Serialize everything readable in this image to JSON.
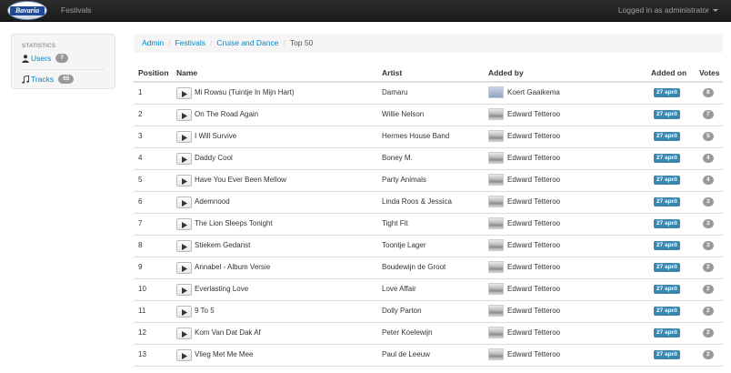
{
  "navbar": {
    "brand": "Bavaria",
    "link": "Festivals",
    "user": "Logged in as administrator"
  },
  "sidebar": {
    "header": "STATISTICS",
    "items": [
      {
        "label": "Users",
        "count": "7",
        "icon": "user-icon"
      },
      {
        "label": "Tracks",
        "count": "65",
        "icon": "music-icon"
      }
    ]
  },
  "breadcrumb": {
    "items": [
      "Admin",
      "Festivals",
      "Cruise and Dance"
    ],
    "current": "Top 50"
  },
  "table": {
    "headers": {
      "position": "Position",
      "name": "Name",
      "artist": "Artist",
      "added_by": "Added by",
      "added_on": "Added on",
      "votes": "Votes"
    },
    "rows": [
      {
        "position": "1",
        "name": "Mi Rowsu (Tuintje In Mijn Hart)",
        "artist": "Damaru",
        "added_by": "Koert Gaaikema",
        "added_on": "27 april",
        "votes": "8"
      },
      {
        "position": "2",
        "name": "On The Road Again",
        "artist": "Willie Nelson",
        "added_by": "Edward Tetteroo",
        "added_on": "27 april",
        "votes": "7"
      },
      {
        "position": "3",
        "name": "I Will Survive",
        "artist": "Hermes House Band",
        "added_by": "Edward Tetteroo",
        "added_on": "27 april",
        "votes": "5"
      },
      {
        "position": "4",
        "name": "Daddy Cool",
        "artist": "Boney M.",
        "added_by": "Edward Tetteroo",
        "added_on": "27 april",
        "votes": "4"
      },
      {
        "position": "5",
        "name": "Have You Ever Been Mellow",
        "artist": "Party Animals",
        "added_by": "Edward Tetteroo",
        "added_on": "27 april",
        "votes": "4"
      },
      {
        "position": "6",
        "name": "Ademnood",
        "artist": "Linda Roos & Jessica",
        "added_by": "Edward Tetteroo",
        "added_on": "27 april",
        "votes": "3"
      },
      {
        "position": "7",
        "name": "The Lion Sleeps Tonight",
        "artist": "Tight Fit",
        "added_by": "Edward Tetteroo",
        "added_on": "27 april",
        "votes": "3"
      },
      {
        "position": "8",
        "name": "Stiekem Gedanst",
        "artist": "Toontje Lager",
        "added_by": "Edward Tetteroo",
        "added_on": "27 april",
        "votes": "3"
      },
      {
        "position": "9",
        "name": "Annabel - Album Versie",
        "artist": "Boudewijn de Groot",
        "added_by": "Edward Tetteroo",
        "added_on": "27 april",
        "votes": "2"
      },
      {
        "position": "10",
        "name": "Everlasting Love",
        "artist": "Love Affair",
        "added_by": "Edward Tetteroo",
        "added_on": "27 april",
        "votes": "2"
      },
      {
        "position": "11",
        "name": "9 To 5",
        "artist": "Dolly Parton",
        "added_by": "Edward Tetteroo",
        "added_on": "27 april",
        "votes": "2"
      },
      {
        "position": "12",
        "name": "Kom Van Dat Dak Af",
        "artist": "Peter Koelewijn",
        "added_by": "Edward Tetteroo",
        "added_on": "27 april",
        "votes": "2"
      },
      {
        "position": "13",
        "name": "Vlieg Met Me Mee",
        "artist": "Paul de Leeuw",
        "added_by": "Edward Tetteroo",
        "added_on": "27 april",
        "votes": "2"
      }
    ]
  },
  "colors": {
    "navbar": "#222222",
    "link": "#0088cc",
    "date_label": "#3a87ad",
    "badge": "#999999"
  }
}
